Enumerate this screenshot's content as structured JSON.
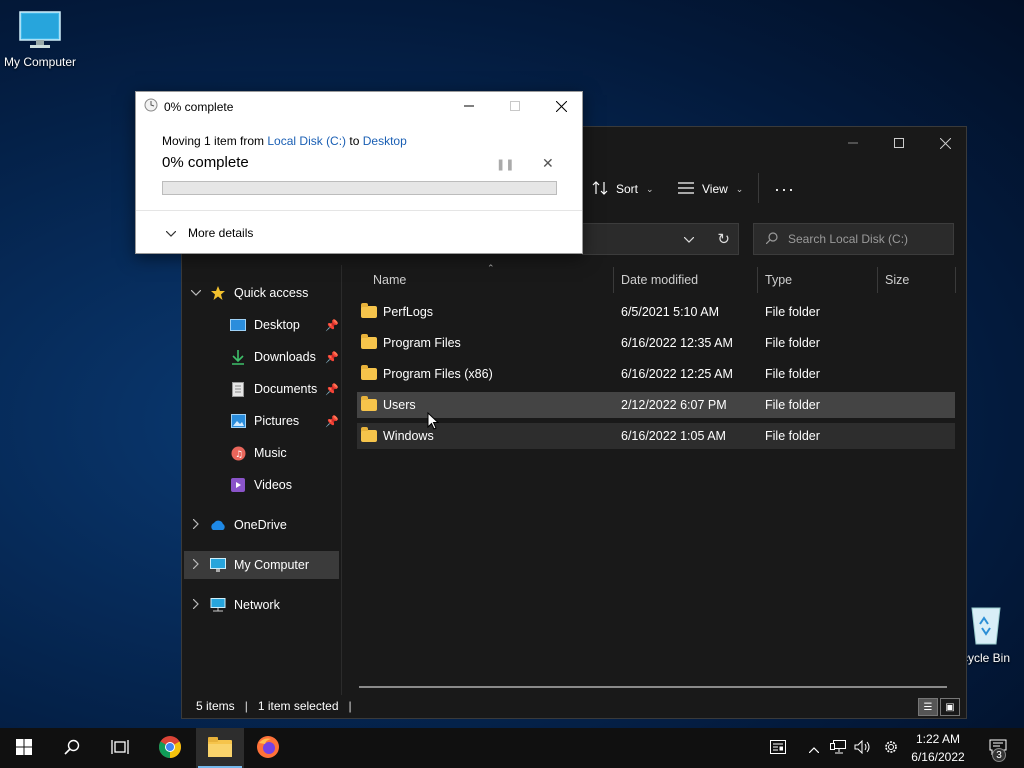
{
  "desktop": {
    "icons": [
      {
        "label": "My Computer"
      },
      {
        "label": "cycle Bin"
      }
    ]
  },
  "explorer": {
    "toolbar": {
      "sort_label": "Sort",
      "view_label": "View",
      "more_label": "···"
    },
    "search_placeholder": "Search Local Disk (C:)",
    "nav": {
      "quick_access": "Quick access",
      "pinned": [
        {
          "label": "Desktop",
          "icon": "desktop-icon"
        },
        {
          "label": "Downloads",
          "icon": "downloads-icon"
        },
        {
          "label": "Documents",
          "icon": "documents-icon"
        },
        {
          "label": "Pictures",
          "icon": "pictures-icon"
        }
      ],
      "unpinned": [
        {
          "label": "Music",
          "icon": "music-icon"
        },
        {
          "label": "Videos",
          "icon": "videos-icon"
        }
      ],
      "onedrive": "OneDrive",
      "my_computer": "My Computer",
      "network": "Network"
    },
    "columns": {
      "name": "Name",
      "date": "Date modified",
      "type": "Type",
      "size": "Size"
    },
    "files": [
      {
        "name": "PerfLogs",
        "date": "6/5/2021 5:10 AM",
        "type": "File folder"
      },
      {
        "name": "Program Files",
        "date": "6/16/2022 12:35 AM",
        "type": "File folder"
      },
      {
        "name": "Program Files (x86)",
        "date": "6/16/2022 12:25 AM",
        "type": "File folder"
      },
      {
        "name": "Users",
        "date": "2/12/2022 6:07 PM",
        "type": "File folder"
      },
      {
        "name": "Windows",
        "date": "6/16/2022 1:05 AM",
        "type": "File folder"
      }
    ],
    "status": {
      "items": "5 items",
      "selected": "1 item selected"
    }
  },
  "dialog": {
    "title": "0% complete",
    "moving_prefix": "Moving 1 item from ",
    "source": "Local Disk (C:)",
    "to_word": " to ",
    "destination": "Desktop",
    "percent_text": "0% complete",
    "progress": 0,
    "more_details": "More details"
  },
  "taskbar": {
    "time": "1:22 AM",
    "date": "6/16/2022",
    "notification_count": "3"
  },
  "colors": {
    "progress_fill": "#06b025",
    "link": "#1a5fb4",
    "folder": "#f6c44b"
  }
}
